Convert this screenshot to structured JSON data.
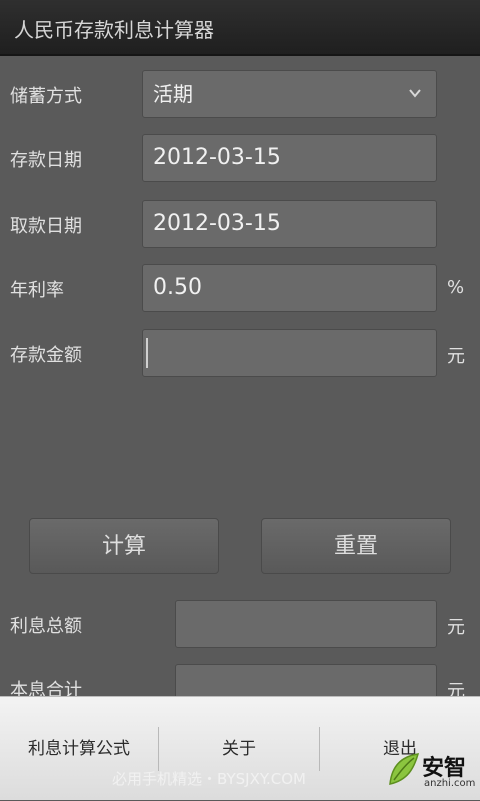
{
  "app": {
    "title": "人民币存款利息计算器"
  },
  "form": {
    "savings_type": {
      "label": "储蓄方式",
      "value": "活期"
    },
    "deposit_date": {
      "label": "存款日期",
      "value": "2012-03-15"
    },
    "withdraw_date": {
      "label": "取款日期",
      "value": "2012-03-15"
    },
    "annual_rate": {
      "label": "年利率",
      "value": "0.50",
      "unit": "%"
    },
    "deposit_amount": {
      "label": "存款金额",
      "value": "",
      "unit": "元"
    }
  },
  "actions": {
    "calculate": "计算",
    "reset": "重置"
  },
  "results": {
    "interest_total": {
      "label": "利息总额",
      "unit": "元"
    },
    "principal_interest_total": {
      "label": "本息合计",
      "unit": "元"
    }
  },
  "menu": {
    "formula": "利息计算公式",
    "about": "关于",
    "exit": "退出"
  },
  "overlay": {
    "watermark": "必用手机精选・BYSJXY.COM",
    "brand": "安智",
    "domain": "anzhi.com"
  }
}
